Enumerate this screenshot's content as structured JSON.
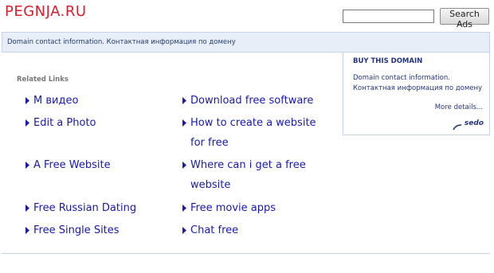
{
  "site": {
    "title": "PEGNJA.RU"
  },
  "search": {
    "placeholder": "",
    "button_label": "Search Ads"
  },
  "info_bar": {
    "text": "Domain contact information. Контактная информация по домену"
  },
  "related": {
    "title": "Related Links",
    "left": [
      "М видео",
      "Edit a Photo",
      "A Free Website",
      "Free Russian Dating",
      "Free Single Sites"
    ],
    "right": [
      "Download free software",
      "How to create a website for free",
      "Where can i get a free website",
      "Free movie apps",
      "Chat free"
    ]
  },
  "sidebar": {
    "heading": "BUY THIS DOMAIN",
    "body": "Domain contact information. Контактная информация по домену",
    "more": "More details...",
    "logo": "sedo"
  },
  "colors": {
    "title": "#d6202f",
    "link": "#1a1aa6",
    "panel": "#e8eef8",
    "panel_border": "#c5d2ea"
  }
}
